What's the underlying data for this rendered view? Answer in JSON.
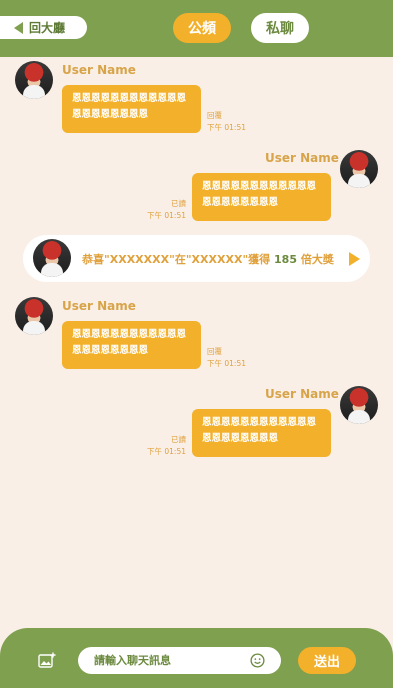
{
  "header": {
    "back_label": "回大廳",
    "tabs": [
      {
        "label": "公頻",
        "active": true
      },
      {
        "label": "私聊",
        "active": false
      }
    ]
  },
  "messages": [
    {
      "side": "left",
      "user": "User Name",
      "text": "恩恩恩恩恩恩恩恩恩恩恩恩恩恩恩恩恩恩恩恩",
      "status": "回覆",
      "time": "下午 01:51"
    },
    {
      "side": "right",
      "user": "User Name",
      "text": "恩恩恩恩恩恩恩恩恩恩恩恩恩恩恩恩恩恩恩恩",
      "status": "已讀",
      "time": "下午 01:51"
    },
    {
      "side": "left",
      "user": "User Name",
      "text": "恩恩恩恩恩恩恩恩恩恩恩恩恩恩恩恩恩恩恩恩",
      "status": "回覆",
      "time": "下午 01:51"
    },
    {
      "side": "right",
      "user": "User Name",
      "text": "恩恩恩恩恩恩恩恩恩恩恩恩恩恩恩恩恩恩恩恩",
      "status": "已讀",
      "time": "下午 01:51"
    }
  ],
  "announcement": {
    "prefix": "恭喜\"XXXXXXX\"在\"XXXXXX\"獲得 ",
    "multiplier": "185",
    "suffix": " 倍大獎"
  },
  "footer": {
    "input_placeholder": "請輸入聊天訊息",
    "send_label": "送出"
  },
  "colors": {
    "header_green": "#7fa04e",
    "accent_orange": "#f2b02b",
    "background": "#f9efe6"
  },
  "icons": [
    "back-arrow-icon",
    "add-image-icon",
    "emoji-icon",
    "play-arrow-icon"
  ]
}
